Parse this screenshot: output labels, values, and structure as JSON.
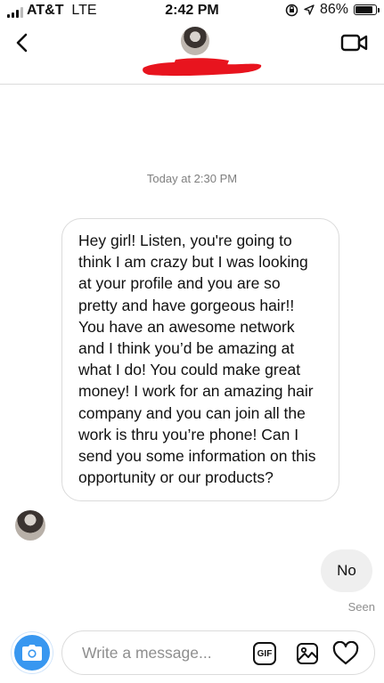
{
  "status_bar": {
    "carrier": "AT&T",
    "network": "LTE",
    "time": "2:42 PM",
    "battery": "86%",
    "battery_level": 0.86,
    "icons": [
      "signal-icon",
      "do-not-disturb-icon",
      "rotation-lock-icon",
      "location-icon",
      "battery-icon"
    ]
  },
  "header": {
    "icons": [
      "back-arrow-icon",
      "avatar",
      "video-camera-icon"
    ]
  },
  "conversation": {
    "timestamp": "Today at 2:30 PM",
    "incoming_message": "Hey girl! Listen, you're going to think I am crazy but I was looking at your profile and you are so pretty and have gorgeous hair!! You have an awesome network and I think you’d be amazing at what I do! You could make great money! I work for an amazing hair company and you can join all the work is thru you’re phone! Can I send you some information on this opportunity or our products?",
    "outgoing_message": "No",
    "seen_label": "Seen"
  },
  "composer": {
    "placeholder": "Write a message...",
    "gif_label": "GIF",
    "icons": [
      "camera-icon",
      "gif-icon",
      "gallery-icon",
      "heart-icon"
    ]
  },
  "colors": {
    "accent": "#3897f0",
    "redaction": "#e8141e",
    "bubble_border": "#dbdbdb",
    "outgoing_bubble": "#efefef"
  }
}
